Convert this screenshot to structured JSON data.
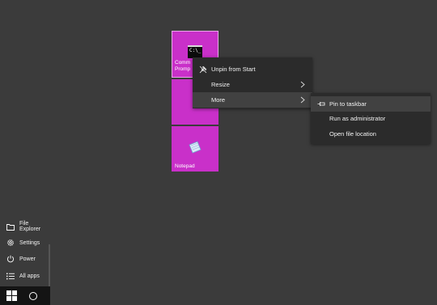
{
  "start_menu": {
    "items": [
      {
        "label": "File Explorer",
        "icon": "folder-icon"
      },
      {
        "label": "Settings",
        "icon": "gear-icon"
      },
      {
        "label": "Power",
        "icon": "power-icon"
      },
      {
        "label": "All apps",
        "icon": "list-icon"
      }
    ]
  },
  "tiles": {
    "cmd_label": "Comm\nPromp",
    "cmd_icon_text": "C:\\_",
    "notepad_label": "Notepad",
    "accent": "#c930c9"
  },
  "context_menu": {
    "items": [
      {
        "label": "Unpin from Start",
        "icon": "unpin-icon"
      },
      {
        "label": "Resize",
        "icon": "chevron-right-icon"
      },
      {
        "label": "More",
        "icon": "chevron-right-icon"
      }
    ]
  },
  "submenu": {
    "items": [
      {
        "label": "Pin to taskbar",
        "icon": "pin-icon"
      },
      {
        "label": "Run as administrator"
      },
      {
        "label": "Open file location"
      }
    ]
  },
  "taskbar": {
    "start_icon": "windows-logo-icon",
    "search_icon": "cortana-icon"
  }
}
